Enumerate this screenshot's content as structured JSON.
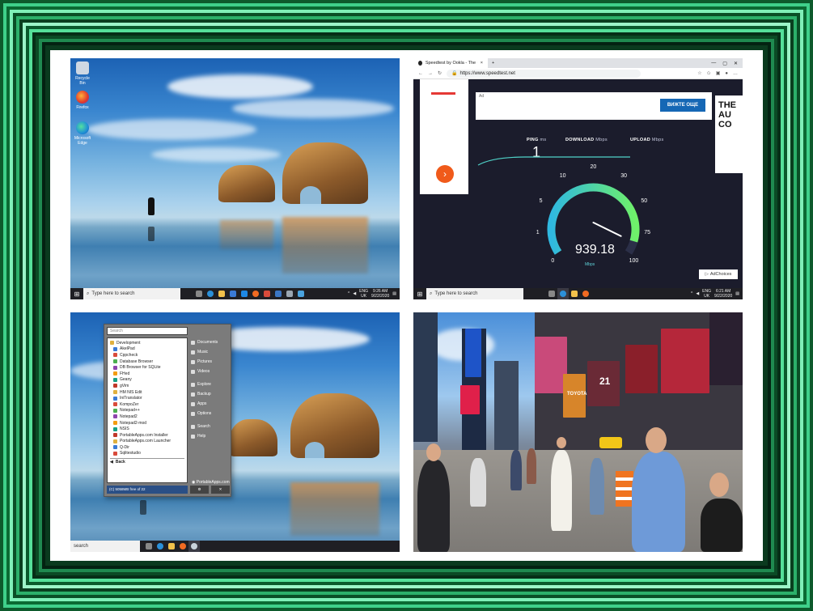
{
  "colors": {
    "frame_dark": "#0a3a1e",
    "frame_light": "#7ff0b8",
    "taskbar": "#1f1f24",
    "speedtest_bg": "#1b1c2c",
    "speedtest_orange": "#f05a1a",
    "ad_button": "#1567b5"
  },
  "panel1": {
    "desktop_icons": [
      {
        "label": "Recycle Bin",
        "icon": "recycle-bin-icon"
      },
      {
        "label": "Firefox",
        "icon": "firefox-icon"
      },
      {
        "label": "Microsoft Edge",
        "icon": "edge-icon"
      }
    ],
    "taskbar": {
      "search_placeholder": "Type here to search",
      "tray_lang": "ENG",
      "tray_region": "UK",
      "clock_time": "9:26 AM",
      "clock_date": "9/22/2020"
    }
  },
  "panel2": {
    "tab_title": "Speedtest by Ookla - The Global",
    "url": "https://www.speedtest.net",
    "ad_label": "Ad",
    "ad_button": "ВИЖТЕ ОЩЕ",
    "ad_right_text": "THE AU CO",
    "metrics": {
      "ping_label": "PING",
      "ping_unit": "ms",
      "download_label": "DOWNLOAD",
      "download_unit": "Mbps",
      "upload_label": "UPLOAD",
      "upload_unit": "Mbps"
    },
    "ping_value": "1",
    "gauge_value": "939.18",
    "gauge_unit": "Mbps",
    "gauge_fraction": 0.93,
    "gauge_ticks": [
      "0",
      "1",
      "5",
      "10",
      "20",
      "30",
      "50",
      "75",
      "100"
    ],
    "adchoices": "AdChoices",
    "taskbar": {
      "search_placeholder": "Type here to search",
      "tray_lang": "ENG",
      "tray_region": "UK",
      "clock_time": "6:21 AM",
      "clock_date": "9/22/2020"
    }
  },
  "panel3": {
    "search_placeholder": "Search",
    "app_list": [
      "Development",
      "AkelPad",
      "Cppcheck",
      "Database Browser",
      "DB Browser for SQLite",
      "FHed",
      "Geany",
      "gVim",
      "HM NIS Edit",
      "IniTranslator",
      "KompoZer",
      "Notepad++",
      "Notepad2",
      "Notepad2-mod",
      "NSIS",
      "PortableApps.com Installer",
      "PortableApps.com Launcher",
      "Q-Dir",
      "Sqlitestudio"
    ],
    "back_label": "Back",
    "right_links": [
      "Documents",
      "Music",
      "Pictures",
      "Videos",
      "Explore",
      "Backup",
      "Apps",
      "Options",
      "Search",
      "Help"
    ],
    "footer_info": "(C) 5058MB free of 22",
    "brand": "PortableApps.com",
    "taskbar_search": "search"
  },
  "panel4": {
    "signs": [
      "TOYOTA",
      "21"
    ]
  }
}
